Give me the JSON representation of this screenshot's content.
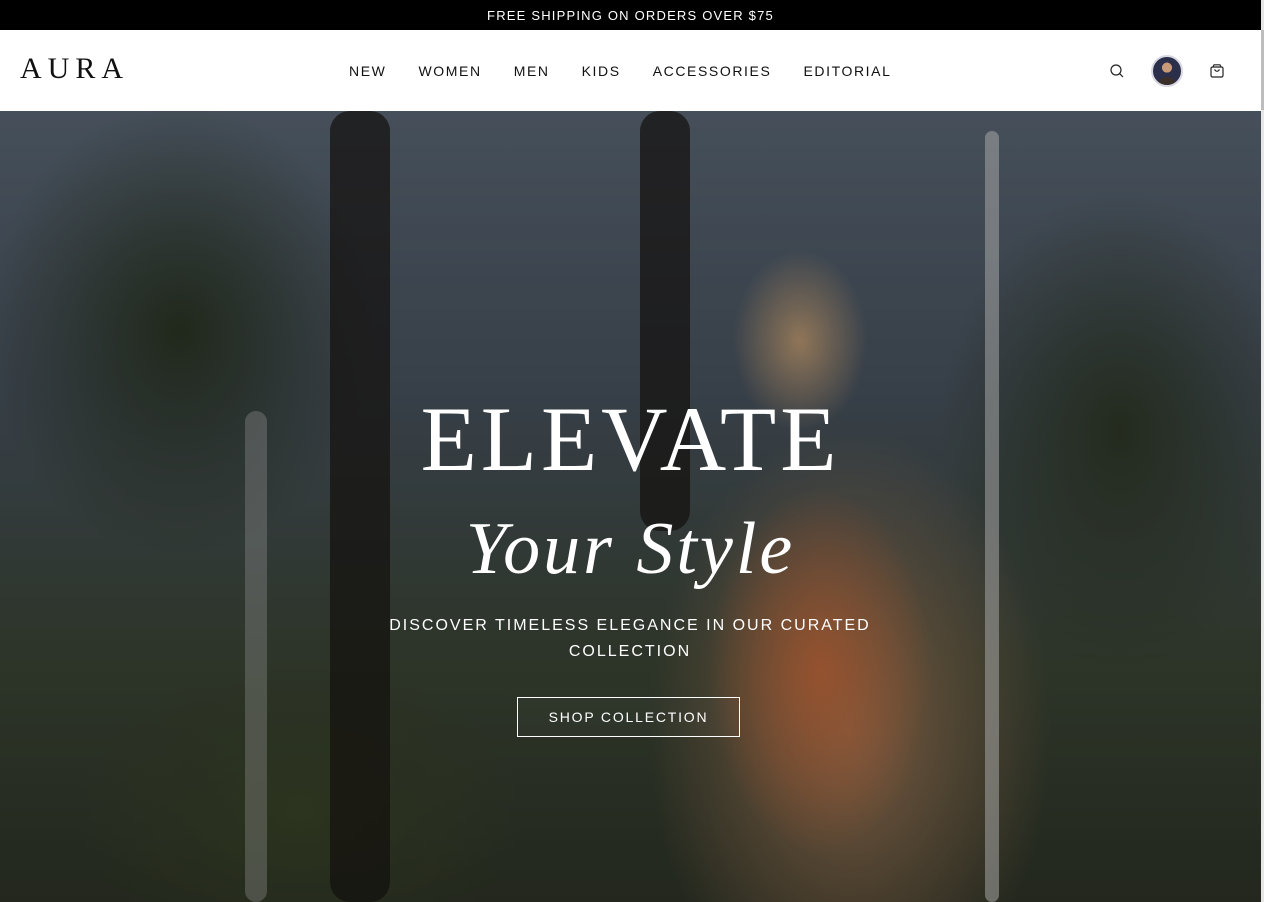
{
  "announcement": {
    "text": "FREE SHIPPING ON ORDERS OVER $75"
  },
  "header": {
    "logo": "AURA",
    "nav": [
      {
        "label": "NEW"
      },
      {
        "label": "WOMEN"
      },
      {
        "label": "MEN"
      },
      {
        "label": "KIDS"
      },
      {
        "label": "ACCESSORIES"
      },
      {
        "label": "EDITORIAL"
      }
    ],
    "icons": [
      "search-icon",
      "user-avatar",
      "shopping-bag-icon"
    ]
  },
  "hero": {
    "title": "ELEVATE",
    "subtitle": "Your Style",
    "tagline": "DISCOVER TIMELESS ELEGANCE IN OUR CURATED COLLECTION",
    "cta_label": "SHOP COLLECTION"
  },
  "colors": {
    "announcement_bg": "#000000",
    "header_bg": "#ffffff",
    "hero_text": "#ffffff"
  }
}
